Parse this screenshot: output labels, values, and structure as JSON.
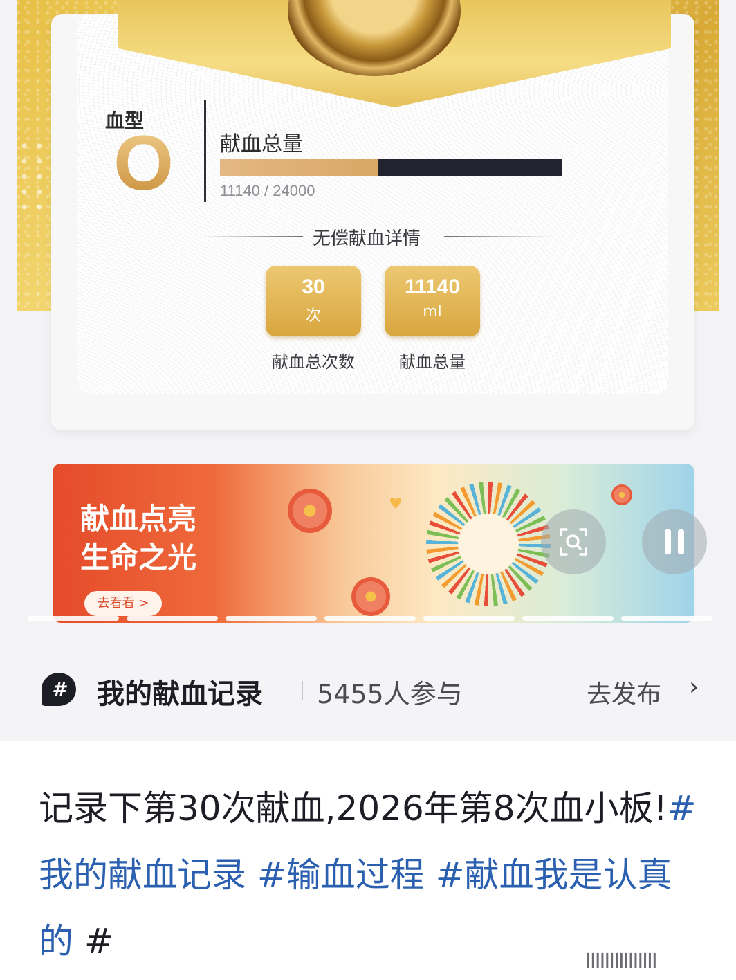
{
  "card": {
    "blood_type_label": "血型",
    "blood_type": "O",
    "total_title": "献血总量",
    "progress_current": 11140,
    "progress_goal": 24000,
    "progress_text": "11140 / 24000",
    "section_title": "无偿献血详情",
    "stats": [
      {
        "value": "30",
        "unit": "次",
        "label": "献血总次数"
      },
      {
        "value": "11140",
        "unit": "ml",
        "label": "献血总量"
      }
    ]
  },
  "banner": {
    "title_line1": "献血点亮",
    "title_line2": "生命之光",
    "button_label": "去看看 >"
  },
  "carousel": {
    "page_count": 7
  },
  "topic": {
    "icon_glyph": "#",
    "name": "我的献血记录",
    "participants": "5455人参与",
    "post_label": "去发布",
    "chevron": "›"
  },
  "post": {
    "text": "记录下第30次献血,2026年第8次血小板!",
    "tags": [
      "#我的献血记录",
      "#输血过程",
      "#献血我是认真的",
      "#"
    ]
  },
  "watermark": "IIIIIIIIIIIIIII",
  "colors": {
    "gold": "#d9a63e",
    "tag_blue": "#2b5fb0",
    "progress_dark": "#23232f"
  }
}
